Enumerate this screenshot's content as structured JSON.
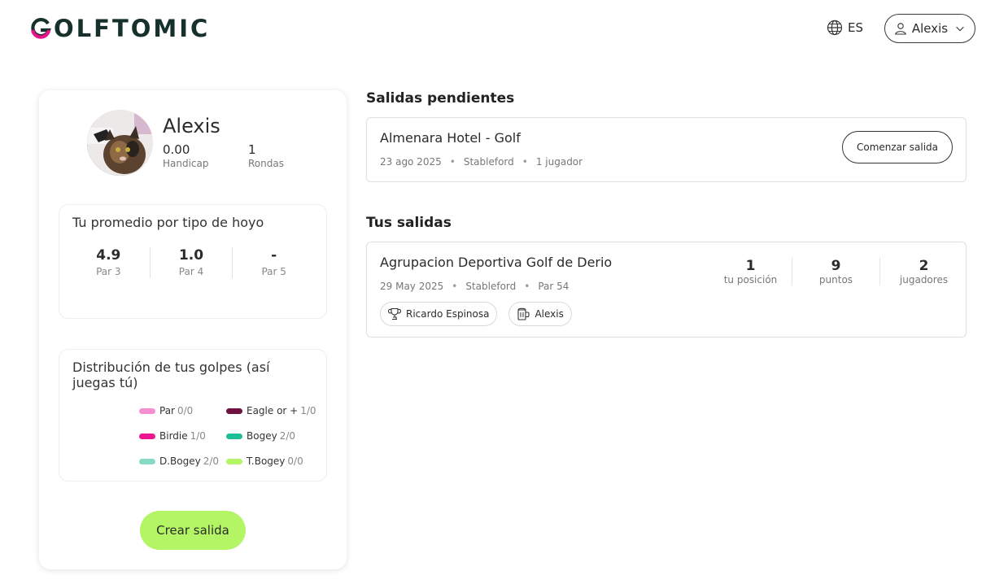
{
  "header": {
    "logo_text": "OLFTOMIC",
    "language": "ES",
    "user_name": "Alexis"
  },
  "profile": {
    "name": "Alexis",
    "handicap_value": "0.00",
    "handicap_label": "Handicap",
    "rounds_value": "1",
    "rounds_label": "Rondas"
  },
  "average": {
    "title": "Tu promedio por tipo de hoyo",
    "columns": [
      {
        "value": "4.9",
        "label": "Par 3"
      },
      {
        "value": "1.0",
        "label": "Par 4"
      },
      {
        "value": "-",
        "label": "Par 5"
      }
    ]
  },
  "distribution": {
    "title": "Distribución de tus golpes (así juegas tú)",
    "legend": [
      {
        "label": "Par",
        "count": "0/0",
        "color": "#f58fcf"
      },
      {
        "label": "Eagle or +",
        "count": "1/0",
        "color": "#6e1240"
      },
      {
        "label": "Birdie",
        "count": "1/0",
        "color": "#ef1790"
      },
      {
        "label": "Bogey",
        "count": "2/0",
        "color": "#1cbf95"
      },
      {
        "label": "D.Bogey",
        "count": "2/0",
        "color": "#86d9c3"
      },
      {
        "label": "T.Bogey",
        "count": "0/0",
        "color": "#b4f565"
      }
    ]
  },
  "create_button": "Crear salida",
  "pending": {
    "section_title": "Salidas pendientes",
    "items": [
      {
        "course": "Almenara Hotel - Golf",
        "date": "23 ago 2025",
        "format": "Stableford",
        "players": "1 jugador",
        "button": "Comenzar salida"
      }
    ]
  },
  "yours": {
    "section_title": "Tus salidas",
    "items": [
      {
        "course": "Agrupacion Deportiva Golf de Derio",
        "date": "29 May 2025",
        "format": "Stableford",
        "par": "Par 54",
        "stats": [
          {
            "value": "1",
            "label": "tu posición"
          },
          {
            "value": "9",
            "label": "puntos"
          },
          {
            "value": "2",
            "label": "jugadores"
          }
        ],
        "chips": [
          {
            "icon": "trophy-icon",
            "label": "Ricardo Espinosa"
          },
          {
            "icon": "beer-mug-icon",
            "label": "Alexis"
          }
        ]
      }
    ]
  },
  "colors": {
    "accent_green": "#b4f565",
    "brand_pink": "#e8128a",
    "brand_dark": "#16302b"
  }
}
